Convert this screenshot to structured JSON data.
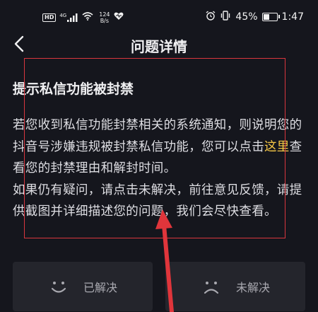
{
  "status_bar": {
    "hd": "HD",
    "signal_label": "4G",
    "net_speed_value": "124",
    "net_speed_unit": "B/s",
    "battery_percent": "45%",
    "battery_level": 0.45,
    "time": "1:47"
  },
  "header": {
    "title": "问题详情"
  },
  "question": {
    "title": "提示私信功能被封禁",
    "body_part1": "若您收到私信功能封禁相关的系统通知，则说明您的抖音号涉嫌违规被封禁私信功能，您可以点击",
    "link_text": "这里",
    "body_part2": "查看您的封禁理由和解封时间。",
    "body_part3": "如果仍有疑问，请点击未解决，前往意见反馈，请提供截图并详细描述您的问题，我们会尽快查看。"
  },
  "feedback": {
    "resolved_label": "已解决",
    "unresolved_label": "未解决"
  },
  "colors": {
    "background": "#15161d",
    "link": "#f7c846",
    "annotation": "#d9363e",
    "button_bg": "#24252c"
  }
}
